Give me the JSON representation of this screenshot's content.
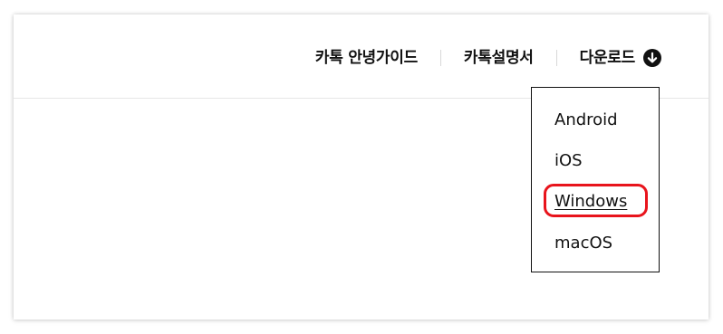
{
  "nav": {
    "guide_label": "카톡 안녕가이드",
    "manual_label": "카톡설명서",
    "download_label": "다운로드",
    "download_icon": "arrow-down-circle-icon"
  },
  "dropdown": {
    "items": [
      {
        "label": "Android"
      },
      {
        "label": "iOS"
      },
      {
        "label": "Windows"
      },
      {
        "label": "macOS"
      }
    ],
    "highlighted_item": "Windows"
  },
  "colors": {
    "highlight": "#e8141c",
    "text": "#111111",
    "divider": "#e6e6e6"
  }
}
